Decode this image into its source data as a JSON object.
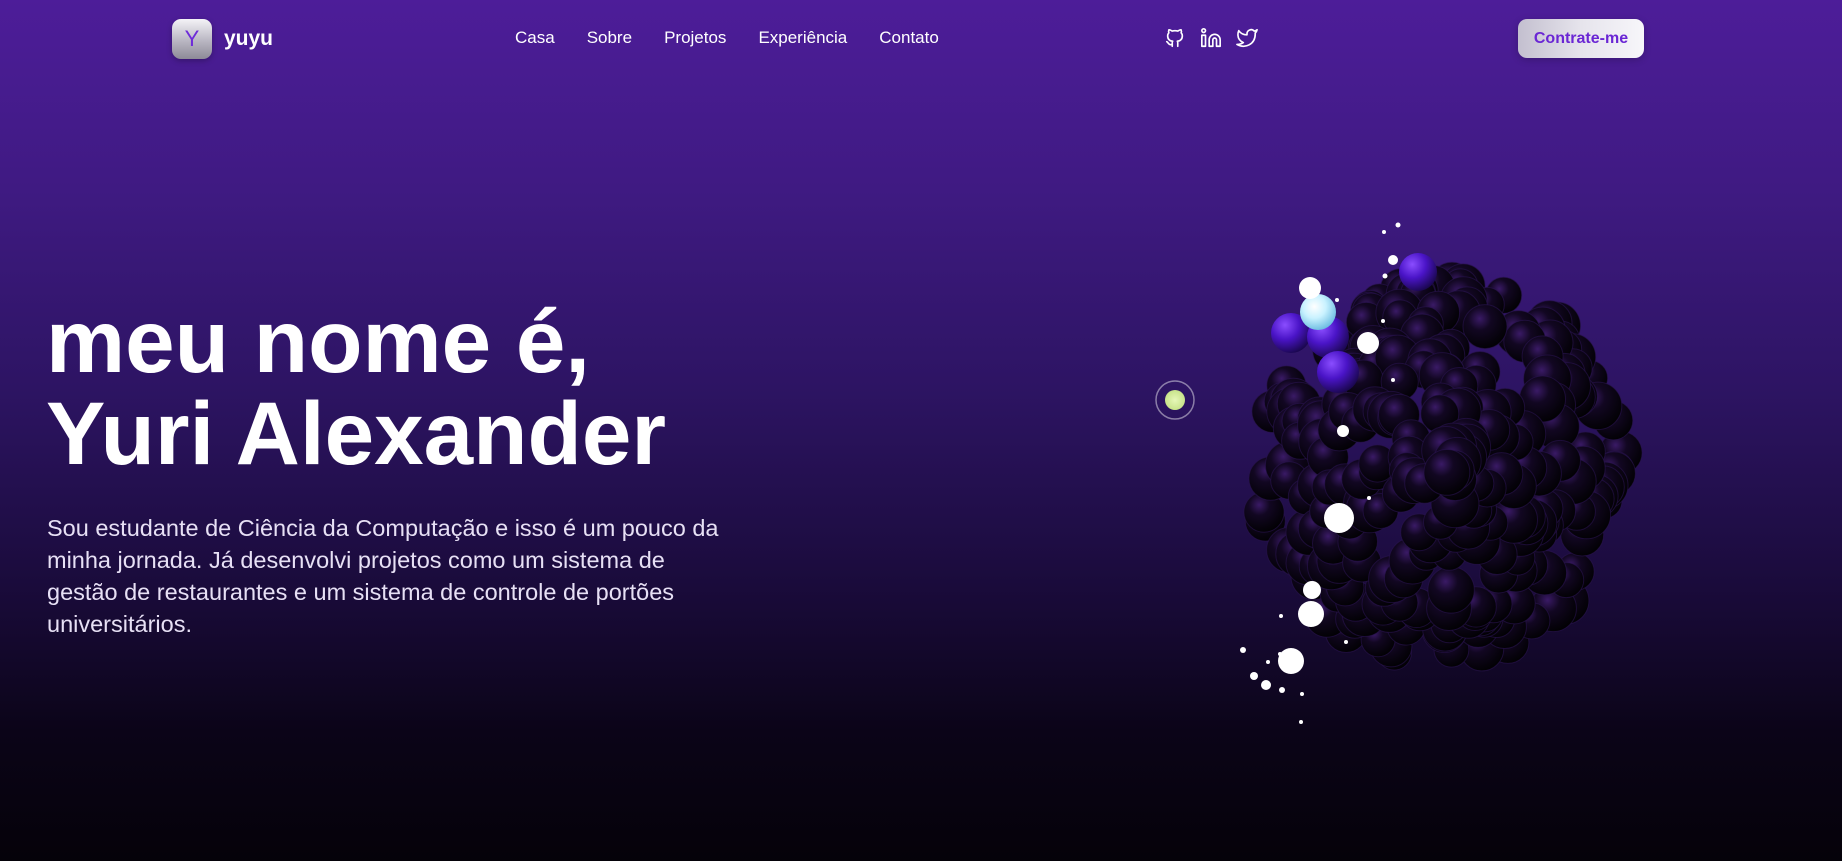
{
  "brand": {
    "logo_letter": "Y",
    "name": "yuyu"
  },
  "nav": {
    "items": [
      "Casa",
      "Sobre",
      "Projetos",
      "Experiência",
      "Contato"
    ]
  },
  "socials": [
    "github-icon",
    "linkedin-icon",
    "twitter-icon"
  ],
  "cta": {
    "label": "Contrate-me"
  },
  "hero": {
    "title_line1": "meu nome é,",
    "title_line2": "Yuri Alexander",
    "description": "Sou estudante de Ciência da Computação e isso é um pouco da minha jornada. Já desenvolvi projetos como um sistema de gestão de restaurantes e um sistema de controle de portões universitários."
  },
  "colors": {
    "accent": "#6a26d4",
    "background_top": "#4d1d99",
    "background_bottom": "#050209",
    "orb_highlight": "#d9f0a8"
  }
}
